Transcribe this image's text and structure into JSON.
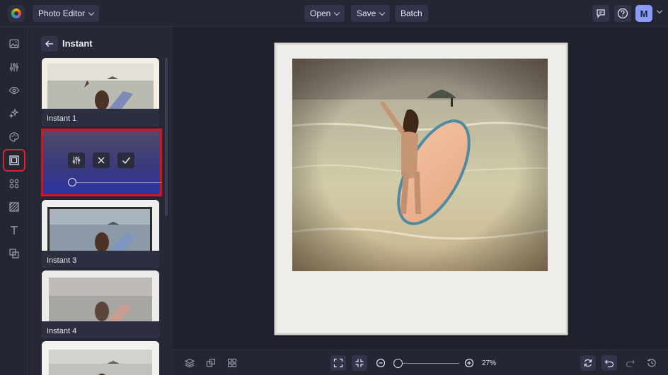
{
  "topbar": {
    "app_menu_label": "Photo Editor",
    "open_label": "Open",
    "save_label": "Save",
    "batch_label": "Batch",
    "avatar_initial": "M"
  },
  "sidebar_tools": [
    "image-icon",
    "adjustments-icon",
    "eye-icon",
    "sparkle-icon",
    "palette-icon",
    "frames-icon",
    "shapes-icon",
    "texture-icon",
    "text-icon",
    "overlay-icon"
  ],
  "panel": {
    "title": "Instant",
    "cards": [
      {
        "label": "Instant 1"
      },
      {
        "label": "Instant 3"
      },
      {
        "label": "Instant 4"
      }
    ]
  },
  "zoom": {
    "value_text": "27%",
    "level_percent": 27
  },
  "colors": {
    "accent_red": "#d6141e",
    "panel_gradient_end": "#2e35a0",
    "background": "#20222e"
  }
}
